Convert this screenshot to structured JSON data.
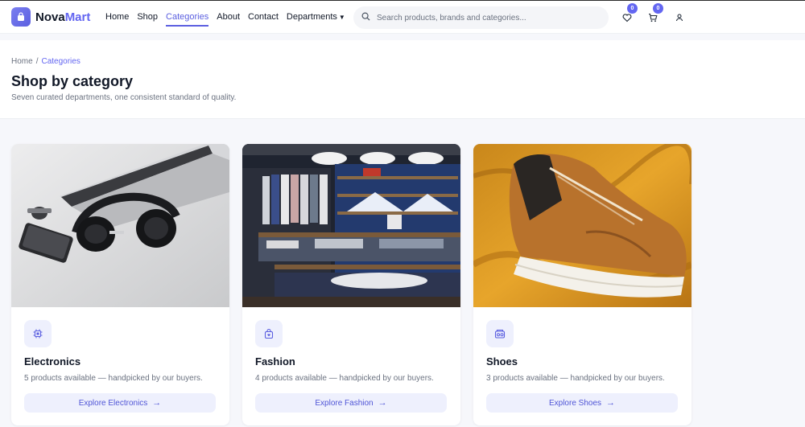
{
  "brand": {
    "name_a": "Nova",
    "name_b": "Mart",
    "accent": "#6366f1"
  },
  "nav": {
    "items": [
      {
        "label": "Home",
        "active": false
      },
      {
        "label": "Shop",
        "active": false
      },
      {
        "label": "Categories",
        "active": true
      },
      {
        "label": "About",
        "active": false
      },
      {
        "label": "Contact",
        "active": false
      }
    ],
    "departments_label": "Departments"
  },
  "search": {
    "placeholder": "Search products, brands and categories..."
  },
  "header_icons": {
    "wishlist": {
      "icon": "heart-icon",
      "count": "0"
    },
    "cart": {
      "icon": "cart-icon",
      "count": "0"
    },
    "account": {
      "icon": "user-icon"
    }
  },
  "breadcrumb": {
    "home": "Home",
    "separator": "/",
    "current": "Categories"
  },
  "page": {
    "title": "Shop by category",
    "subtitle": "Seven curated departments, one consistent standard of quality."
  },
  "categories": [
    {
      "name": "Electronics",
      "icon": "chip-icon",
      "count_text": "5 products available — handpicked by our buyers.",
      "button": "Explore Electronics"
    },
    {
      "name": "Fashion",
      "icon": "shopping-bag-icon",
      "count_text": "4 products available — handpicked by our buyers.",
      "button": "Explore Fashion"
    },
    {
      "name": "Shoes",
      "icon": "boombox-icon",
      "count_text": "3 products available — handpicked by our buyers.",
      "button": "Explore Shoes"
    }
  ]
}
